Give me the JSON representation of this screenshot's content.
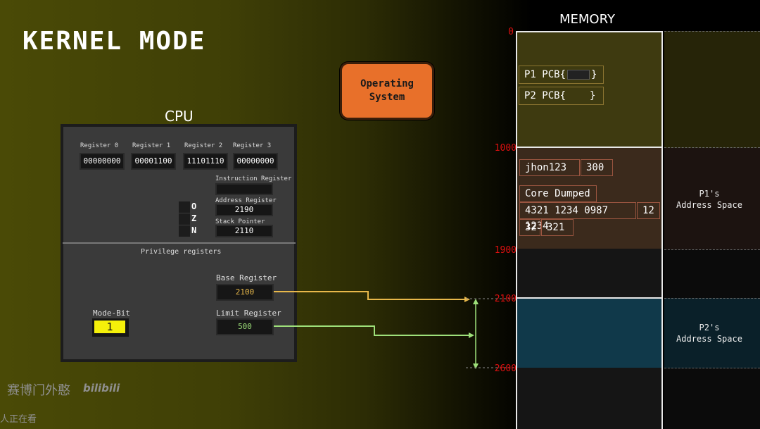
{
  "title": "KERNEL MODE",
  "os_label": "Operating\nSystem",
  "cpu": {
    "label": "CPU",
    "registers": [
      {
        "label": "Register 0",
        "value": "00000000"
      },
      {
        "label": "Register 1",
        "value": "00001100"
      },
      {
        "label": "Register 2",
        "value": "11101110"
      },
      {
        "label": "Register 3",
        "value": "00000000"
      }
    ],
    "instruction_register_label": "Instruction Register",
    "instruction_register_value": "",
    "address_register_label": "Address Register",
    "address_register_value": "2190",
    "stack_pointer_label": "Stack Pointer",
    "stack_pointer_value": "2110",
    "flags": [
      "O",
      "Z",
      "N"
    ],
    "privilege_label": "Privilege registers",
    "base_register_label": "Base Register",
    "base_register_value": "2100",
    "limit_register_label": "Limit Register",
    "limit_register_value": "500",
    "mode_bit_label": "Mode-Bit",
    "mode_bit_value": "1"
  },
  "memory": {
    "title": "MEMORY",
    "addresses": [
      "0",
      "1000",
      "1900",
      "2100",
      "2600"
    ],
    "pcb": [
      "P1 PCB{",
      "}",
      "P2 PCB{",
      "}"
    ],
    "p1_cells": {
      "row1": [
        "jhon123",
        "300"
      ],
      "row2": [
        "Core Dumped"
      ],
      "row3": [
        "4321 1234 0987 1234",
        "12"
      ],
      "row4": [
        "32",
        "321"
      ]
    },
    "p1_space": "P1's\nAddress Space",
    "p2_space": "P2's\nAddress Space"
  },
  "watermark": {
    "channel": "赛博门外憨",
    "logo": "bilibili",
    "viewers": "人正在看"
  },
  "colors": {
    "os_box": "#e8702a",
    "base_arrow": "#e8b84a",
    "limit_arrow": "#9ee07a",
    "mode_bit": "#f5f00a",
    "address_red": "#e01010",
    "p2_block": "#10394a",
    "p1_block": "#3b2a1c",
    "os_block": "#3e3a10"
  }
}
